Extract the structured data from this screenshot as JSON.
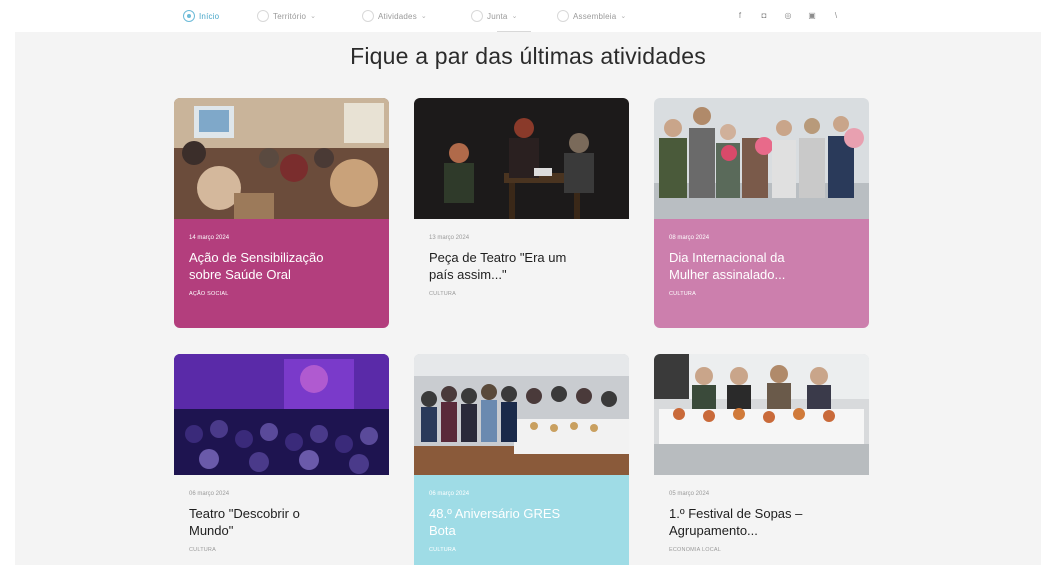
{
  "nav": {
    "items": [
      {
        "label": "Início",
        "active": true,
        "has_dropdown": false
      },
      {
        "label": "Território",
        "active": false,
        "has_dropdown": true
      },
      {
        "label": "Atividades",
        "active": false,
        "has_dropdown": true
      },
      {
        "label": "Junta",
        "active": false,
        "has_dropdown": true
      },
      {
        "label": "Assembleia",
        "active": false,
        "has_dropdown": true
      }
    ],
    "social": [
      {
        "icon": "facebook-icon",
        "glyph": "f"
      },
      {
        "icon": "instagram-icon",
        "glyph": "◘"
      },
      {
        "icon": "whatsapp-icon",
        "glyph": "◎"
      },
      {
        "icon": "youtube-icon",
        "glyph": "▣"
      },
      {
        "icon": "rss-icon",
        "glyph": "\\"
      }
    ]
  },
  "section": {
    "heading": "Fique a par das últimas atividades"
  },
  "cards": [
    {
      "date": "14 março 2024",
      "title_line1": "Ação de Sensibilização",
      "title_line2": "sobre Saúde Oral",
      "category": "AÇÃO SOCIAL",
      "bg": "#b33e7d",
      "style": "colored"
    },
    {
      "date": "13 março 2024",
      "title_line1": "Peça de Teatro \"Era um",
      "title_line2": "país assim...\"",
      "category": "CULTURA",
      "bg": "#f4f4f4",
      "style": "plain"
    },
    {
      "date": "08 março 2024",
      "title_line1": "Dia Internacional da",
      "title_line2": "Mulher assinalado...",
      "category": "CULTURA",
      "bg": "#cc7fad",
      "style": "colored"
    },
    {
      "date": "06 março 2024",
      "title_line1": "Teatro \"Descobrir o",
      "title_line2": "Mundo\"",
      "category": "CULTURA",
      "bg": "#f4f4f4",
      "style": "plain"
    },
    {
      "date": "06 março 2024",
      "title_line1": "48.º Aniversário GRES",
      "title_line2": "Bota",
      "category": "CULTURA",
      "bg": "#9fdce6",
      "style": "colored"
    },
    {
      "date": "05 março 2024",
      "title_line1": "1.º Festival de Sopas –",
      "title_line2": "Agrupamento...",
      "category": "ECONOMIA LOCAL",
      "bg": "#f4f4f4",
      "style": "plain"
    }
  ]
}
